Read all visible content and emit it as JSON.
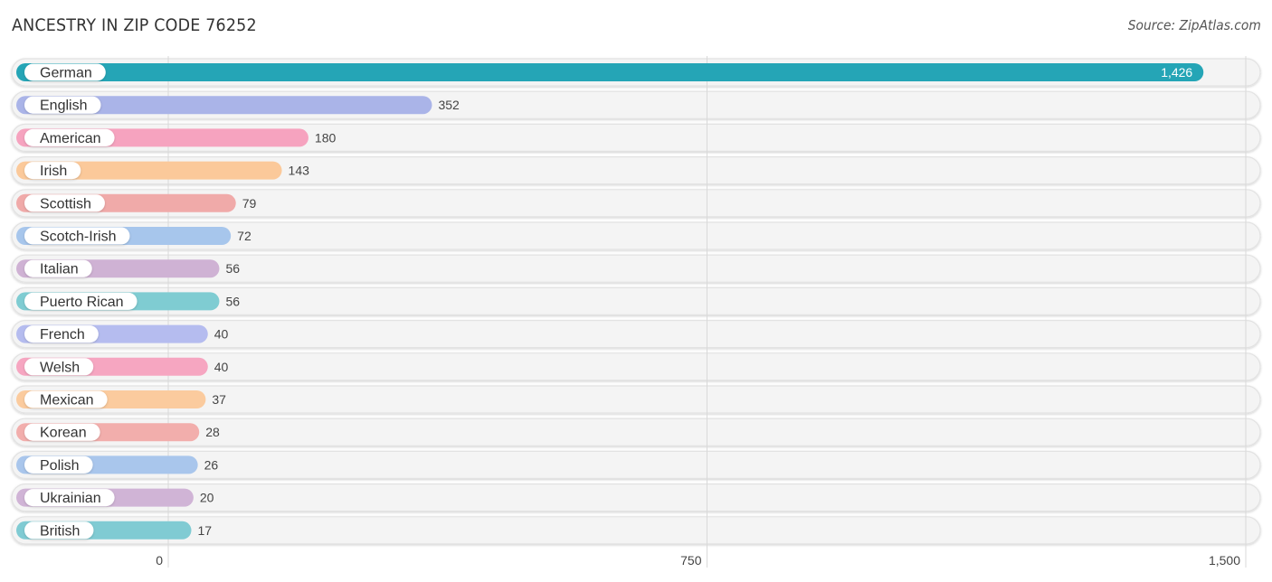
{
  "header": {
    "title": "ANCESTRY IN ZIP CODE 76252",
    "source": "Source: ZipAtlas.com"
  },
  "chart_data": {
    "type": "bar",
    "orientation": "horizontal",
    "title": "ANCESTRY IN ZIP CODE 76252",
    "xlabel": "",
    "ylabel": "",
    "xlim": [
      0,
      1500
    ],
    "xticks": [
      0,
      750,
      1500
    ],
    "xtick_labels": [
      "0",
      "750",
      "1,500"
    ],
    "grid": true,
    "categories": [
      "German",
      "English",
      "American",
      "Irish",
      "Scottish",
      "Scotch-Irish",
      "Italian",
      "Puerto Rican",
      "French",
      "Welsh",
      "Mexican",
      "Korean",
      "Polish",
      "Ukrainian",
      "British"
    ],
    "values": [
      1426,
      352,
      180,
      143,
      79,
      72,
      56,
      56,
      40,
      40,
      37,
      28,
      26,
      20,
      17
    ],
    "value_labels": [
      "1,426",
      "352",
      "180",
      "143",
      "79",
      "72",
      "56",
      "56",
      "40",
      "40",
      "37",
      "28",
      "26",
      "20",
      "17"
    ],
    "colors": [
      "#25a5b6",
      "#aab4e8",
      "#f6a3bf",
      "#fbc99a",
      "#f0aaa9",
      "#a7c6ec",
      "#cfb2d4",
      "#7fccd2",
      "#b5bcef",
      "#f6a6c1",
      "#fbcb9e",
      "#f2aeac",
      "#a9c6ec",
      "#d0b4d6",
      "#80cbd3"
    ]
  }
}
